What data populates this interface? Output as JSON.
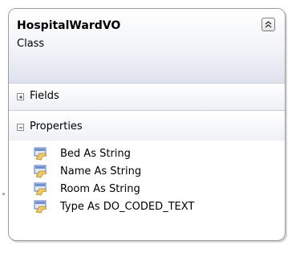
{
  "class_box": {
    "name": "HospitalWardVO",
    "kind": "Class",
    "collapse_icon": "double-chevron-up-icon"
  },
  "compartments": {
    "fields": {
      "label": "Fields",
      "state": "collapsed",
      "toggle_icon": "plus-box-icon"
    },
    "properties": {
      "label": "Properties",
      "state": "expanded",
      "toggle_icon": "minus-box-icon",
      "items": [
        {
          "text": "Bed As String",
          "icon": "property-icon"
        },
        {
          "text": "Name As String",
          "icon": "property-icon"
        },
        {
          "text": "Room As String",
          "icon": "property-icon"
        },
        {
          "text": "Type As DO_CODED_TEXT",
          "icon": "property-icon"
        }
      ]
    }
  },
  "colors": {
    "border": "#9b9b9b",
    "header_gradient_end": "#dfe2ee",
    "icon_hand": "#f0c96a",
    "icon_card": "#5a77b8"
  }
}
